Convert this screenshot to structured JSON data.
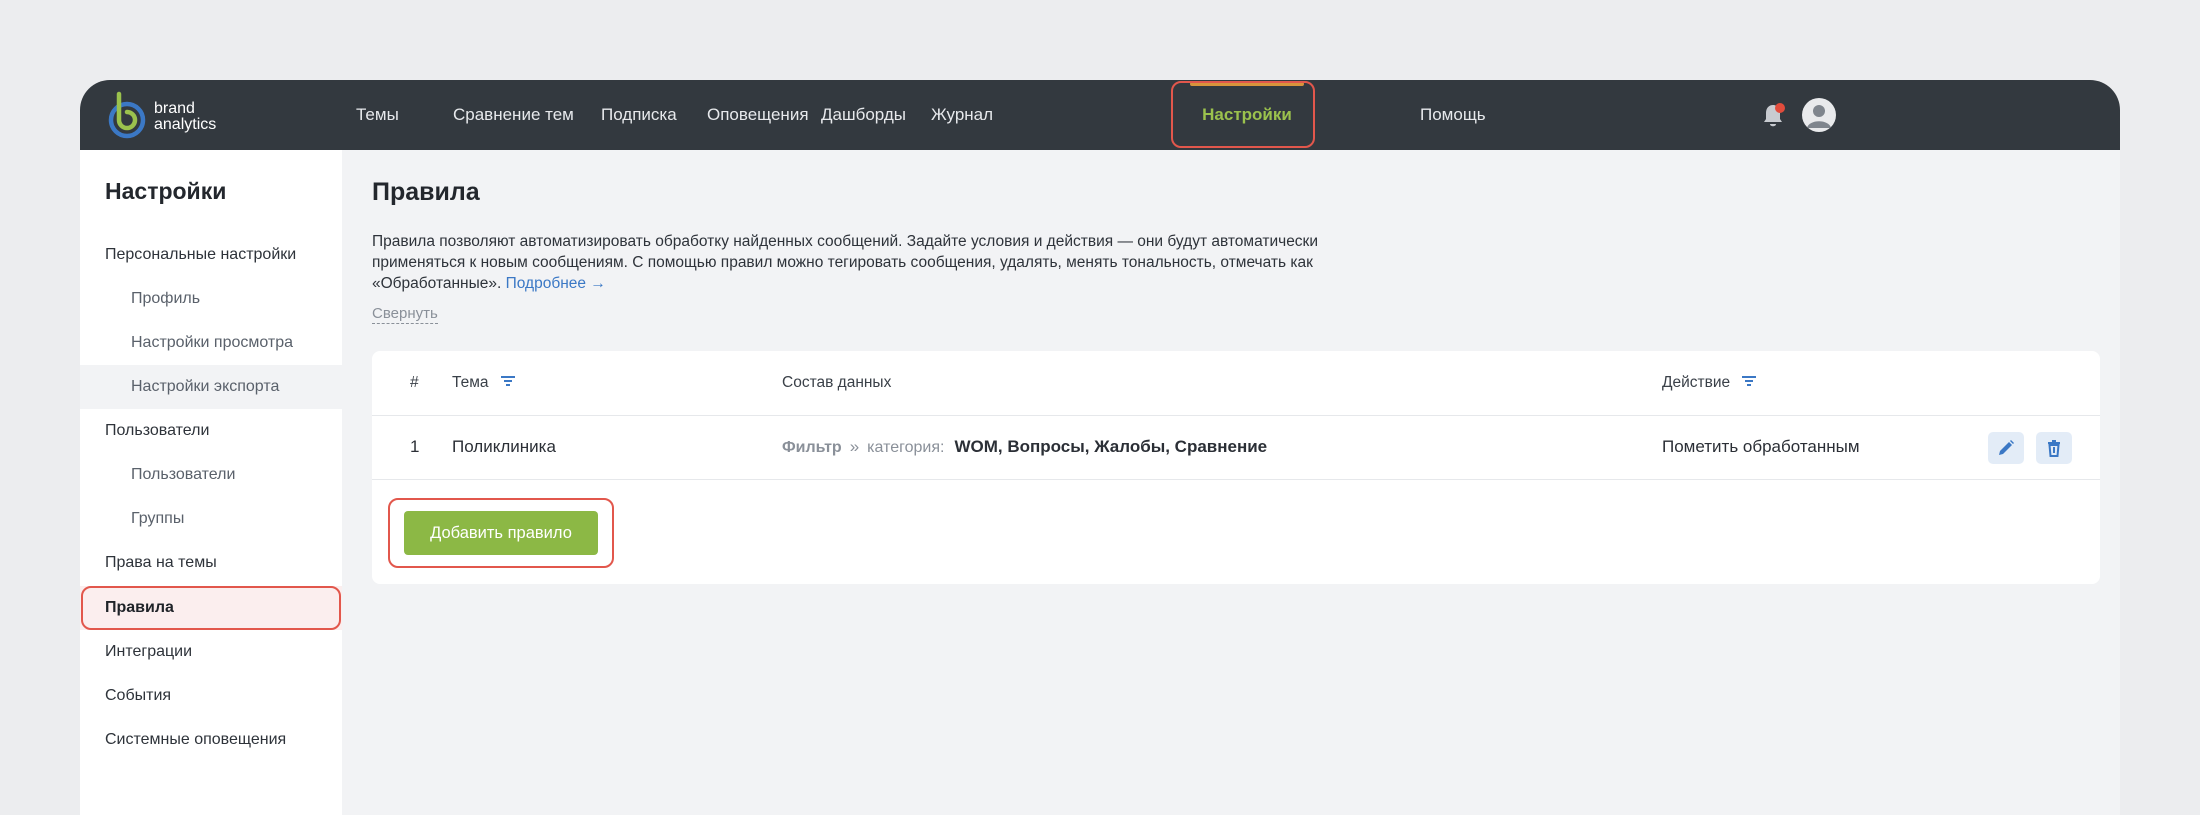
{
  "brand": {
    "line1": "brand",
    "line2": "analytics",
    "colors": {
      "ring": "#3b78c5",
      "arc": "#9bc24d"
    }
  },
  "nav": {
    "items": [
      "Темы",
      "Сравнение тем",
      "Подписка",
      "Оповещения",
      "Дашборды",
      "Журнал",
      "Настройки",
      "Помощь"
    ],
    "active": "Настройки",
    "active_color": "#9bc24d"
  },
  "header_icons": {
    "notifications": "bell-icon",
    "user": "avatar-icon",
    "badge_color": "#e24c3c"
  },
  "sidebar": {
    "title": "Настройки",
    "items": [
      {
        "label": "Персональные настройки",
        "level": 0
      },
      {
        "label": "Профиль",
        "level": 1
      },
      {
        "label": "Настройки просмотра",
        "level": 1
      },
      {
        "label": "Настройки экспорта",
        "level": 1
      },
      {
        "label": "Пользователи",
        "level": 0
      },
      {
        "label": "Пользователи",
        "level": 1
      },
      {
        "label": "Группы",
        "level": 1
      },
      {
        "label": "Права на темы",
        "level": 0
      },
      {
        "label": "Правила",
        "level": 0,
        "active": true
      },
      {
        "label": "Интеграции",
        "level": 0
      },
      {
        "label": "События",
        "level": 0
      },
      {
        "label": "Системные оповещения",
        "level": 0
      }
    ]
  },
  "main": {
    "title": "Правила",
    "description": "Правила позволяют автоматизировать обработку найденных сообщений. Задайте условия и действия — они будут автоматически применяться к новым сообщениям. С помощью правил можно тегировать сообщения, удалять, менять тональность, отмечать как «Обработанные».",
    "more_link": "Подробнее →",
    "collapse": "Свернуть",
    "table": {
      "columns": {
        "num": "#",
        "theme": "Тема",
        "data": "Состав данных",
        "action": "Действие"
      },
      "rows": [
        {
          "num": "1",
          "theme": "Поликлиника",
          "filter_label": "Фильтр",
          "filter_sep": "»",
          "filter_key": "категория:",
          "filter_values": "WOM, Вопросы, Жалобы, Сравнение",
          "action": "Пометить обработанным"
        }
      ]
    },
    "add_button": "Добавить правило",
    "accent": "#8cb845",
    "highlight": "#e2574c"
  }
}
